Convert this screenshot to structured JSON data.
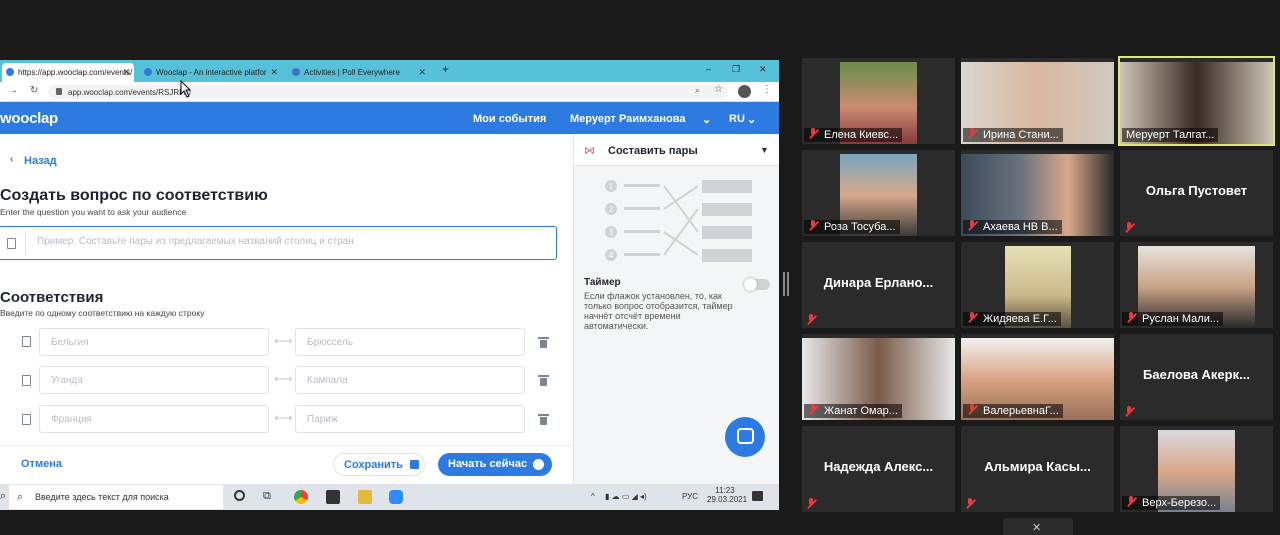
{
  "browser": {
    "tabs": [
      {
        "label": "https://app.wooclap.com/events/"
      },
      {
        "label": "Wooclap - An interactive platfor"
      },
      {
        "label": "Activities | Poll Everywhere"
      }
    ],
    "url": "app.wooclap.com/events/RSJ",
    "url_tail": "RF/0"
  },
  "app": {
    "logo": "wooclap",
    "nav_events": "Мои события",
    "nav_user": "Меруерт Раимханова",
    "nav_lang": "RU",
    "back": "Назад",
    "title": "Создать вопрос по соответствию",
    "subtitle": "Enter the question you want to ask your audience",
    "question_placeholder": "Пример: Составьте пары из предлагаемых названий столиц и стран",
    "matches_title": "Соответствия",
    "matches_sub": "Введите по одному соответствию на каждую строку",
    "rows": [
      {
        "left": "Бельгия",
        "right": "Брюссель"
      },
      {
        "left": "Уганда",
        "right": "Кампала"
      },
      {
        "left": "Франция",
        "right": "Париж"
      }
    ],
    "cancel": "Отмена",
    "save": "Сохранить",
    "start": "Начать сейчас",
    "panel_type": "Составить пары",
    "timer_label": "Таймер",
    "timer_desc": "Если флажок установлен, то, как только вопрос отобразится, таймер начнёт отсчёт времени автоматически.",
    "diagram_numbers": [
      "1",
      "2",
      "3",
      "4"
    ]
  },
  "taskbar": {
    "search": "Введите здесь текст для поиска",
    "lang": "РУС",
    "time": "11:23",
    "date": "29.03.2021"
  },
  "participants": [
    {
      "name": "Елена Киевс..."
    },
    {
      "name": "Ирина Стани..."
    },
    {
      "name": "Меруерт Талгат..."
    },
    {
      "name": "Роза Тосуба..."
    },
    {
      "name": "Ахаева НВ В..."
    },
    {
      "name": "Ольга Пустовет"
    },
    {
      "name": "Динара Ерлано..."
    },
    {
      "name": "Жидяева Е.Г..."
    },
    {
      "name": "Руслан Мали..."
    },
    {
      "name": "Жанат Омар..."
    },
    {
      "name": "ВалерьевнаГ..."
    },
    {
      "name": "Баелова Акерк..."
    },
    {
      "name": "Надежда Алекс..."
    },
    {
      "name": "Альмира Касы..."
    },
    {
      "name": "Верх-Березо..."
    }
  ],
  "colors": {
    "accent": "#2d7be0",
    "chrome": "#57c1d9",
    "active_speaker": "#dfe57a",
    "muted": "#e63b3b"
  }
}
